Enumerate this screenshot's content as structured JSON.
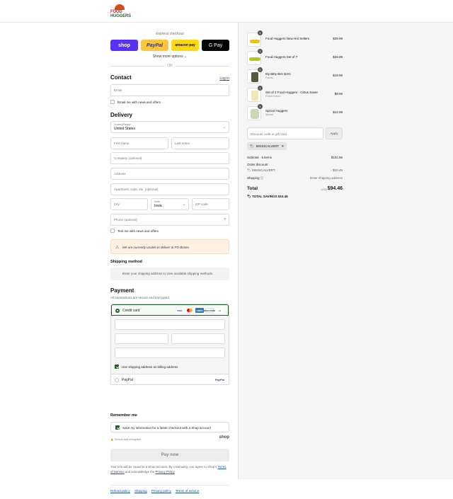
{
  "brand": {
    "line1": "FOOD",
    "line2": "HUGGERS"
  },
  "express": {
    "label": "Express checkout",
    "buttons": {
      "shop": "shop",
      "paypal": "PayPal",
      "amazon": "amazon pay",
      "gpay": "G Pay"
    },
    "show_more": "Show more options ⌄",
    "or": "OR"
  },
  "contact": {
    "title": "Contact",
    "login": "Log in",
    "email_placeholder": "Email",
    "news_label": "Email me with news and offers"
  },
  "delivery": {
    "title": "Delivery",
    "country_label": "Country/Region",
    "country_value": "United States",
    "first_name": "First name",
    "last_name": "Last name",
    "company": "Company (optional)",
    "address": "Address",
    "apartment": "Apartment, suite, etc. (optional)",
    "city": "City",
    "state_label": "State",
    "state_value": "Iowa",
    "zip": "ZIP code",
    "phone": "Phone (optional)",
    "text_news_label": "Text me with news and offers",
    "warning": "We are currently unable to deliver to PO Boxes."
  },
  "shipping_method": {
    "title": "Shipping method",
    "placeholder": "Enter your shipping address to view available shipping methods."
  },
  "payment": {
    "title": "Payment",
    "subtitle": "All transactions are secure and encrypted.",
    "credit_card": "Credit card",
    "card_icons": {
      "visa": "VISA",
      "amex": "AMEX",
      "discover": "DISCOVER",
      "more": "+4"
    },
    "billing_label": "Use shipping address as billing address",
    "paypal": "PayPal",
    "paypal_logo": "PayPal"
  },
  "remember": {
    "title": "Remember me",
    "save_label": "Save my information for a faster checkout with a Shop account",
    "secure": "Secure and encrypted",
    "shop": "shop"
  },
  "pay_now": "Pay now",
  "legal": {
    "text1": "Your info will be saved to a Shop account. By continuing, you agree to Shop's",
    "terms": "Terms of Service",
    "text2": "and acknowledge the",
    "privacy": "Privacy Policy"
  },
  "footer": [
    "Refund policy",
    "Shipping",
    "Privacy policy",
    "Terms of service"
  ],
  "cart": {
    "items": [
      {
        "qty": "1",
        "name": "Food Huggers New Hot Sellers",
        "variant": "",
        "price": "$29.99"
      },
      {
        "qty": "1",
        "name": "Food Huggers Set of 7",
        "variant": "",
        "price": "$29.99"
      },
      {
        "qty": "1",
        "name": "Itty Bitty BIG BAG",
        "variant": "Forest",
        "price": "$19.99"
      },
      {
        "qty": "1",
        "name": "Set of 2 Food Huggers - Citrus Saver",
        "variant": "Fresh Green",
        "price": "$9.99"
      },
      {
        "qty": "1",
        "name": "Sprout Huggers",
        "variant": "Sprout",
        "price": "$14.99"
      }
    ],
    "discount_placeholder": "Discount code or gift card",
    "apply": "Apply",
    "applied_code": "MISSICALVERT",
    "subtotal_label": "Subtotal · 5 items",
    "subtotal": "$104.95",
    "order_discount_label": "Order discount",
    "discount_code": "MISSICALVERT",
    "discount_amount": "- $10.49",
    "shipping_label": "Shipping ⓘ",
    "shipping_value": "Enter shipping address",
    "total_label": "Total",
    "currency": "USD",
    "total": "$94.46",
    "savings": "TOTAL SAVINGS $10.49"
  }
}
